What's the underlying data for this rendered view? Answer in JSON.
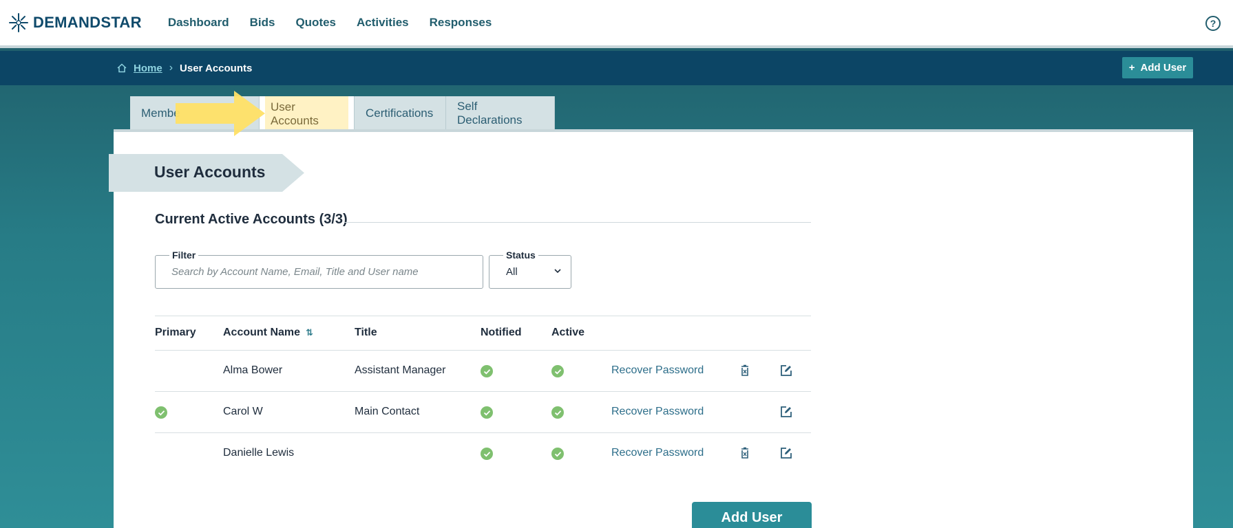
{
  "brand": {
    "name": "DEMANDSTAR"
  },
  "nav": {
    "links": [
      "Dashboard",
      "Bids",
      "Quotes",
      "Activities",
      "Responses"
    ],
    "help_icon": "question-circle-icon"
  },
  "breadcrumb": {
    "home": "Home",
    "current": "User Accounts"
  },
  "header_button": {
    "label": "Add User",
    "icon": "plus-icon"
  },
  "tabs": [
    {
      "label": "Member Info",
      "visible_text": "Membe",
      "active": false
    },
    {
      "label": "User Accounts",
      "active": true
    },
    {
      "label": "Certifications",
      "active": false
    },
    {
      "label": "Self Declarations",
      "active": false
    }
  ],
  "section": {
    "title": "User Accounts",
    "subheading": "Current Active Accounts (3/3)"
  },
  "filter": {
    "legend": "Filter",
    "placeholder": "Search by Account Name, Email, Title and User name",
    "value": ""
  },
  "status": {
    "legend": "Status",
    "value": "All"
  },
  "table": {
    "headers": [
      "Primary",
      "Account Name",
      "Title",
      "Notified",
      "Active"
    ],
    "rows": [
      {
        "primary": false,
        "name": "Alma Bower",
        "title": "Assistant Manager",
        "notified": true,
        "active": true,
        "recover": "Recover Password",
        "deletable": true
      },
      {
        "primary": true,
        "name": "Carol W",
        "title": "Main Contact",
        "notified": true,
        "active": true,
        "recover": "Recover Password",
        "deletable": false
      },
      {
        "primary": false,
        "name": "Danielle Lewis",
        "title": "",
        "notified": true,
        "active": true,
        "recover": "Recover Password",
        "deletable": true
      }
    ]
  },
  "footer_button": {
    "label": "Add User"
  },
  "colors": {
    "accent": "#2b8d98",
    "nav_bar": "#0c4565",
    "check": "#7fc06f",
    "highlight": "#fff2c4",
    "arrow": "#ffe066"
  }
}
